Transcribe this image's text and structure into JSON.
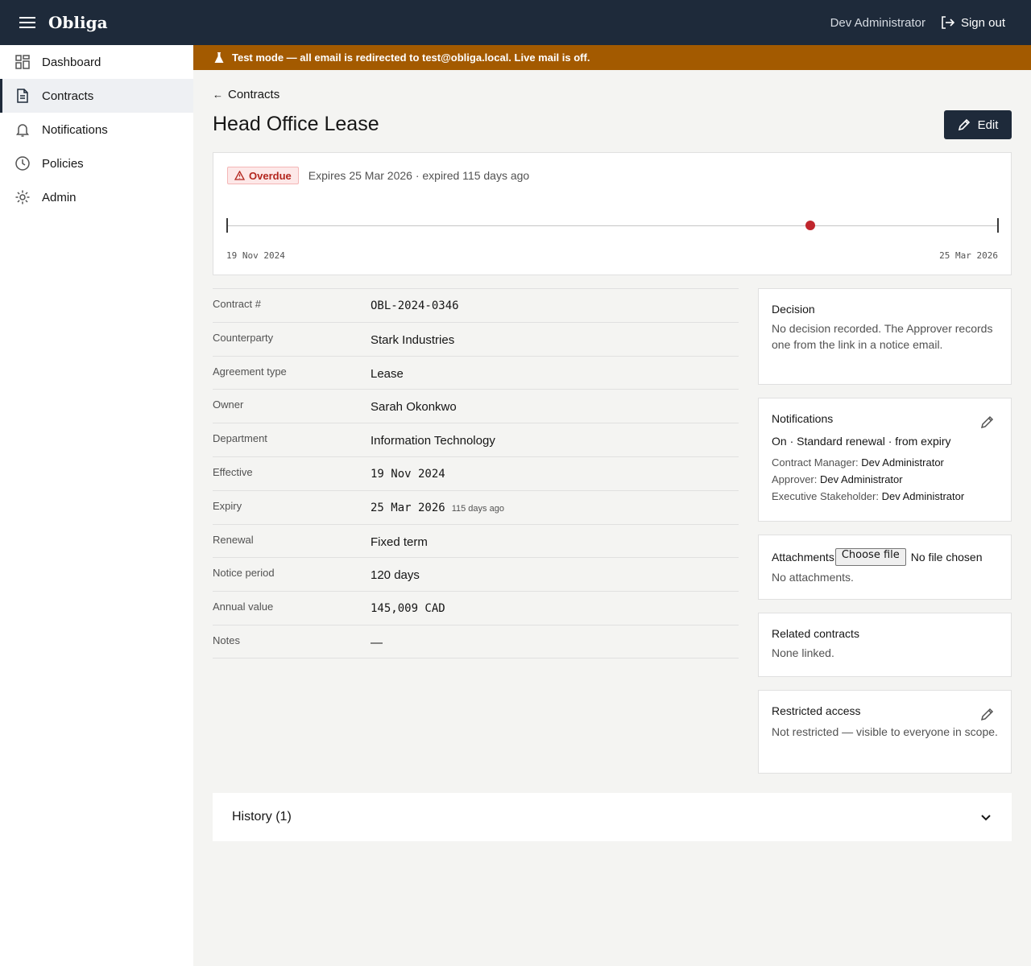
{
  "app": {
    "brand": "Obliga",
    "user_name": "Dev Administrator",
    "sign_out_label": "Sign out"
  },
  "sidebar": {
    "items": [
      {
        "label": "Dashboard",
        "icon": "dashboard-icon"
      },
      {
        "label": "Contracts",
        "icon": "document-icon",
        "active": true
      },
      {
        "label": "Notifications",
        "icon": "bell-icon"
      },
      {
        "label": "Policies",
        "icon": "clock-icon"
      },
      {
        "label": "Admin",
        "icon": "gear-icon"
      }
    ]
  },
  "banner": {
    "text": "Test mode — all email is redirected to test@obliga.local. Live mail is off.",
    "color": "#a35a00"
  },
  "page": {
    "back_label": "Contracts",
    "title": "Head Office Lease",
    "edit_label": "Edit"
  },
  "timeline": {
    "status_badge": "Overdue",
    "status_text": "Expires 25 Mar 2026 · expired 115 days ago",
    "start_label": "19 Nov 2024",
    "end_label": "25 Mar 2026",
    "today_position_fraction": 0.756,
    "status_color": "#c0262d"
  },
  "details": [
    {
      "label": "Contract #",
      "value": "OBL-2024-0346",
      "mono": true
    },
    {
      "label": "Counterparty",
      "value": "Stark Industries"
    },
    {
      "label": "Agreement type",
      "value": "Lease"
    },
    {
      "label": "Owner",
      "value": "Sarah Okonkwo"
    },
    {
      "label": "Department",
      "value": "Information Technology"
    },
    {
      "label": "Effective",
      "value": "19 Nov 2024",
      "mono": true
    },
    {
      "label": "Expiry",
      "value": "25 Mar 2026",
      "mono": true,
      "sub": "115 days ago"
    },
    {
      "label": "Renewal",
      "value": "Fixed term"
    },
    {
      "label": "Notice period",
      "value": "120 days"
    },
    {
      "label": "Annual value",
      "value": "145,009 CAD",
      "mono": true
    },
    {
      "label": "Notes",
      "value": "—"
    }
  ],
  "decision": {
    "title": "Decision",
    "text": "No decision recorded. The Approver records one from the link in a notice email."
  },
  "notifications_card": {
    "title": "Notifications",
    "summary": "On · Standard renewal · from expiry",
    "roles": [
      {
        "role": "Contract Manager:",
        "who": "Dev Administrator"
      },
      {
        "role": "Approver:",
        "who": "Dev Administrator"
      },
      {
        "role": "Executive Stakeholder:",
        "who": "Dev Administrator"
      }
    ]
  },
  "attachments": {
    "title": "Attachments",
    "choose_label": "Choose file",
    "no_file": "No file chosen",
    "empty_text": "No attachments."
  },
  "related": {
    "title": "Related contracts",
    "text": "None linked."
  },
  "restricted": {
    "title": "Restricted access",
    "text": "Not restricted — visible to everyone in scope."
  },
  "history": {
    "label": "History (1)"
  }
}
